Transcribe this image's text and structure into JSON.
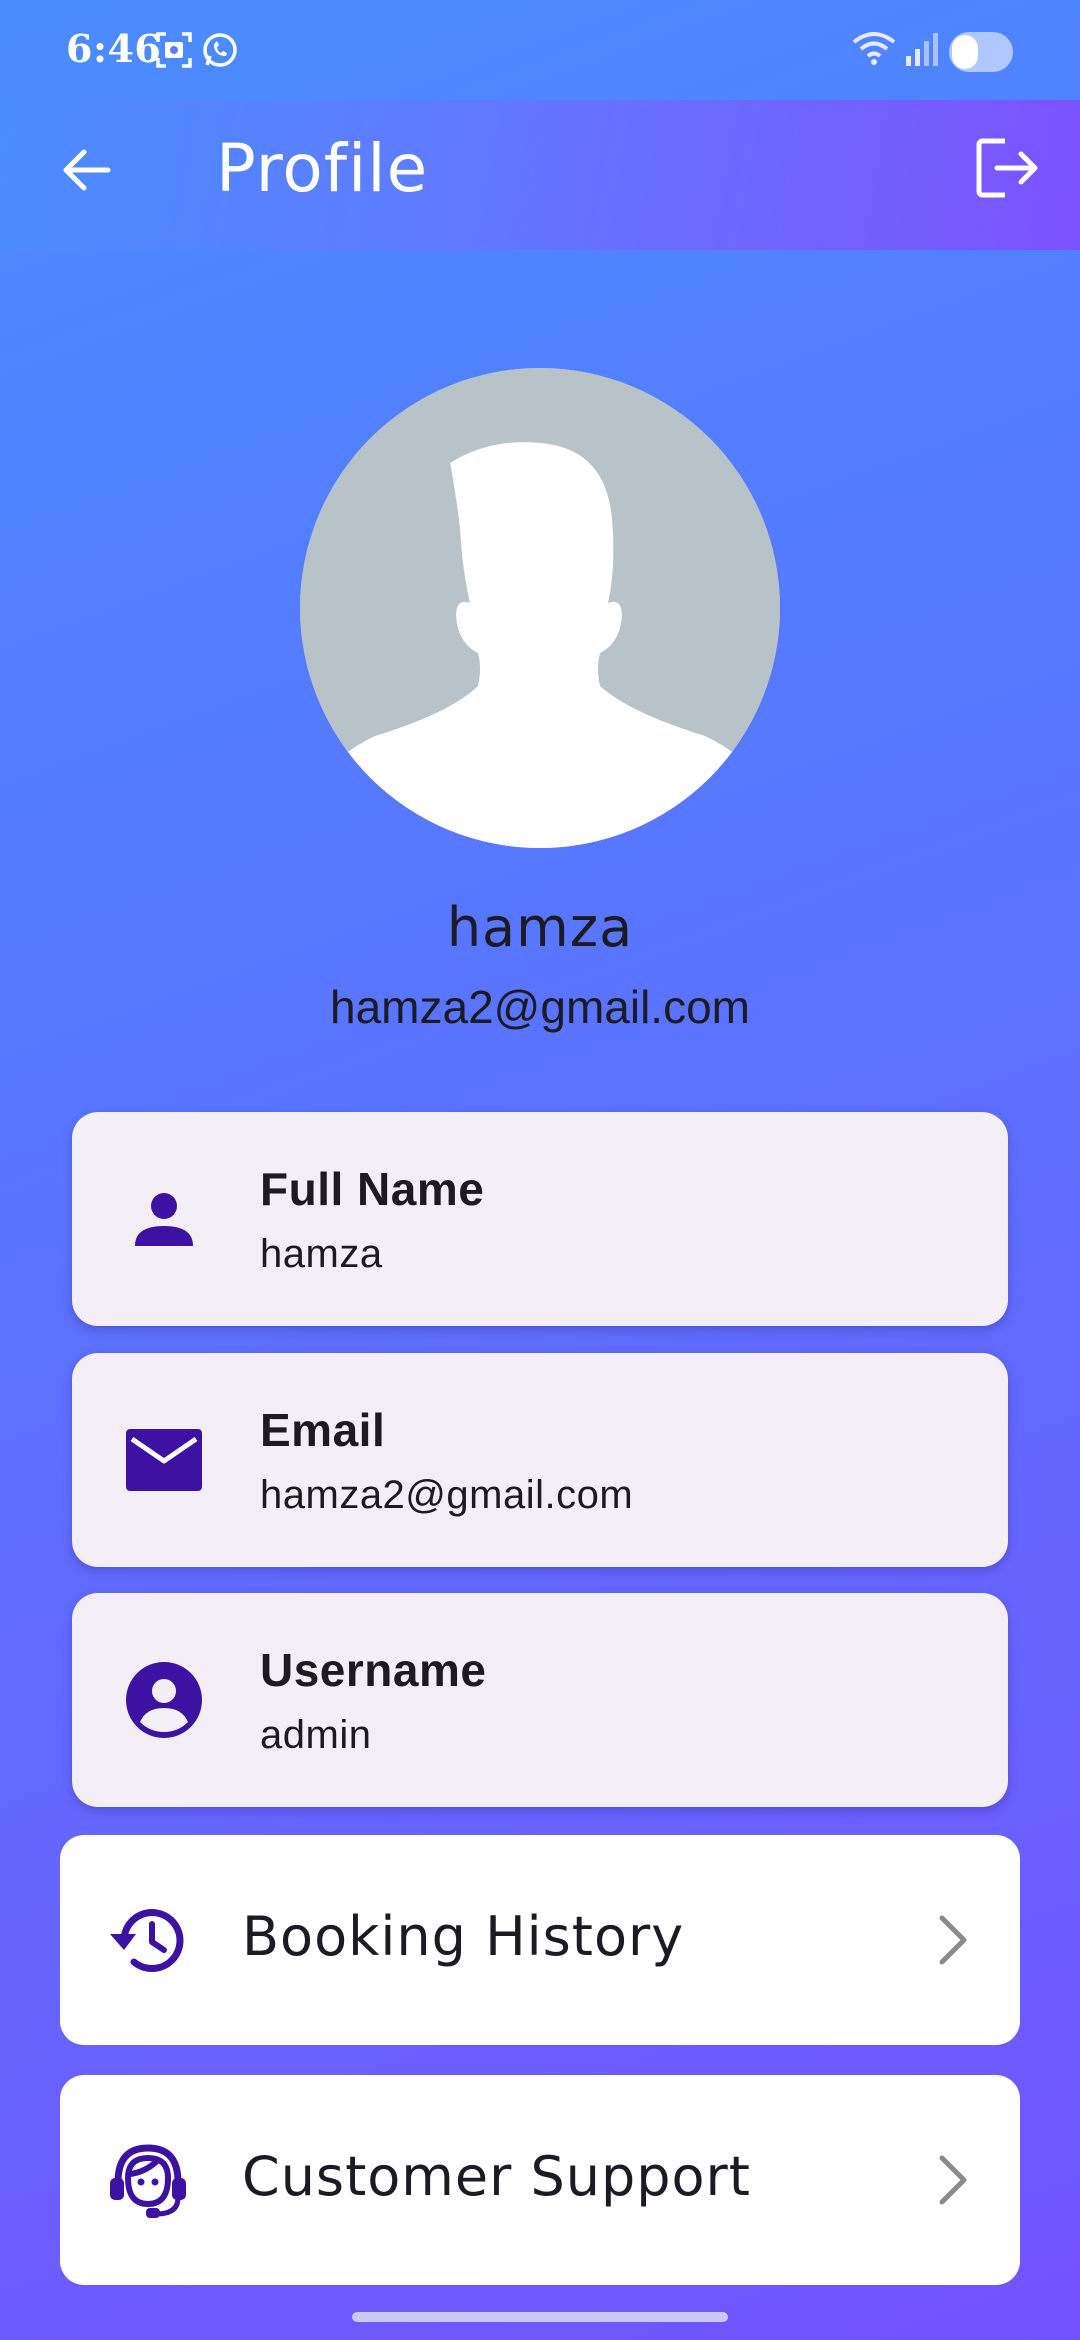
{
  "status_bar": {
    "time": "6:46",
    "icons": [
      "screenshot-icon",
      "whatsapp-icon",
      "wifi-icon",
      "signal-icon",
      "battery-toggle-icon"
    ]
  },
  "app_bar": {
    "title": "Profile",
    "back_icon": "arrow-left-icon",
    "logout_icon": "logout-icon"
  },
  "profile": {
    "name": "hamza",
    "email": "hamza2@gmail.com"
  },
  "info_cards": [
    {
      "icon": "person-icon",
      "label": "Full Name",
      "value": "hamza"
    },
    {
      "icon": "mail-icon",
      "label": "Email",
      "value": "hamza2@gmail.com"
    },
    {
      "icon": "account-circle-icon",
      "label": "Username",
      "value": "admin"
    }
  ],
  "actions": [
    {
      "icon": "history-icon",
      "label": "Booking History"
    },
    {
      "icon": "support-agent-icon",
      "label": "Customer Support"
    }
  ],
  "colors": {
    "accent": "#3d12a3",
    "card_bg": "#f4eff6",
    "gradient_start": "#4a8cff",
    "gradient_end": "#7353ff"
  }
}
